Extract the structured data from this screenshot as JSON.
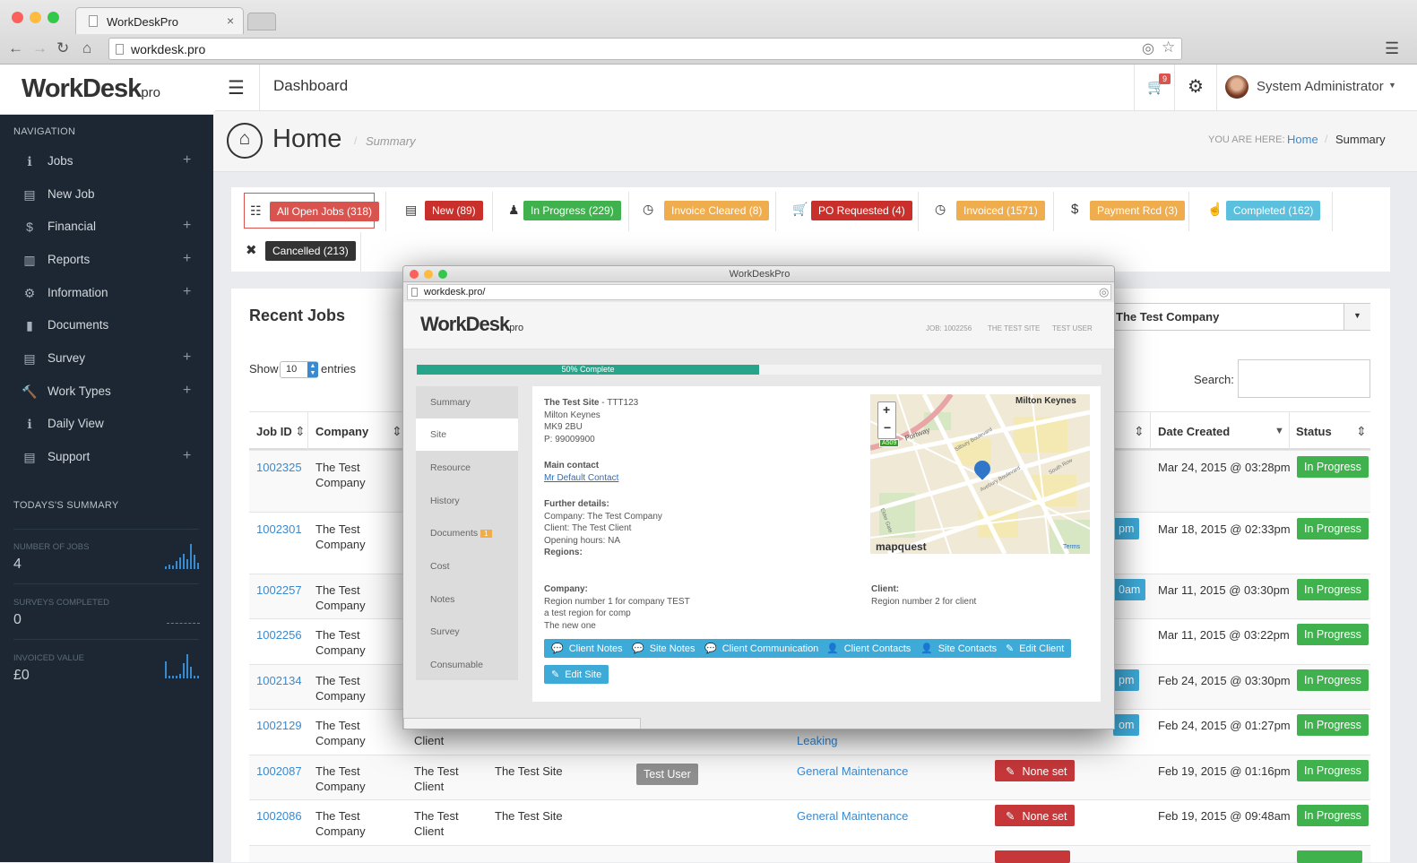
{
  "browser": {
    "tab_title": "WorkDeskPro",
    "url": "workdesk.pro"
  },
  "header": {
    "brand": "WorkDesk",
    "brand_suffix": "pro",
    "title": "Dashboard",
    "cart_count": "9",
    "user": "System Administrator"
  },
  "sidebar": {
    "heading": "NAVIGATION",
    "items": [
      {
        "label": "Jobs",
        "icon": "info-icon",
        "plus": "+"
      },
      {
        "label": "New Job",
        "icon": "list-icon",
        "plus": ""
      },
      {
        "label": "Financial",
        "icon": "dollar-icon",
        "plus": "+"
      },
      {
        "label": "Reports",
        "icon": "bar-chart-icon",
        "plus": "+"
      },
      {
        "label": "Information",
        "icon": "gears-icon",
        "plus": "+"
      },
      {
        "label": "Documents",
        "icon": "file-icon",
        "plus": ""
      },
      {
        "label": "Survey",
        "icon": "list-alt-icon",
        "plus": "+"
      },
      {
        "label": "Work Types",
        "icon": "wrench-icon",
        "plus": "+"
      },
      {
        "label": "Daily View",
        "icon": "info-icon",
        "plus": ""
      },
      {
        "label": "Support",
        "icon": "list-alt-icon",
        "plus": "+"
      }
    ],
    "summary_heading": "TODAYS'S SUMMARY",
    "stats": [
      {
        "label": "NUMBER OF JOBS",
        "value": "4"
      },
      {
        "label": "SURVEYS COMPLETED",
        "value": "0"
      },
      {
        "label": "INVOICED VALUE",
        "value": "£0"
      }
    ]
  },
  "page": {
    "title": "Home",
    "subtitle": "Summary",
    "you_are_here": "YOU ARE HERE:",
    "crumb_home": "Home",
    "crumb_current": "Summary"
  },
  "filters": [
    {
      "label": "All Open Jobs (318)",
      "color": "#d9534f"
    },
    {
      "label": "New (89)",
      "color": "#c9302c"
    },
    {
      "label": "In Progress (229)",
      "color": "#3fb24e"
    },
    {
      "label": "Invoice Cleared (8)",
      "color": "#f0ad4e"
    },
    {
      "label": "PO Requested (4)",
      "color": "#c9302c"
    },
    {
      "label": "Invoiced (1571)",
      "color": "#f0ad4e"
    },
    {
      "label": "Payment Rcd (3)",
      "color": "#f0ad4e"
    },
    {
      "label": "Completed (162)",
      "color": "#5bc0de"
    },
    {
      "label": "Cancelled (213)",
      "color": "#333333"
    }
  ],
  "recent": {
    "title": "Recent Jobs",
    "show": "Show",
    "entries_value": "10",
    "entries": "entries",
    "search_label": "Search:",
    "company_select": "The Test Company",
    "columns": {
      "job_id": "Job ID",
      "company": "Company",
      "date": "Date Created",
      "status": "Status"
    },
    "rows": [
      {
        "id": "1002325",
        "company": "The Test Company",
        "date": "Mar 24, 2015 @ 03:28pm",
        "status": "In Progress"
      },
      {
        "id": "1002301",
        "company": "The Test Company",
        "date": "Mar 18, 2015 @ 02:33pm",
        "status": "In Progress"
      },
      {
        "id": "1002257",
        "company": "The Test Company",
        "date": "Mar 11, 2015 @ 03:30pm",
        "status": "In Progress"
      },
      {
        "id": "1002256",
        "company": "The Test Company",
        "date": "Mar 11, 2015 @ 03:22pm",
        "status": "In Progress"
      },
      {
        "id": "1002134",
        "company": "The Test Company",
        "date": "Feb 24, 2015 @ 03:30pm",
        "status": "In Progress"
      },
      {
        "id": "1002129",
        "company": "The Test Company",
        "client": "Client",
        "worktype": "Leaking",
        "date": "Feb 24, 2015 @ 01:27pm",
        "status": "In Progress"
      },
      {
        "id": "1002087",
        "company": "The Test Company",
        "client": "The Test Client",
        "site": "The Test Site",
        "user": "Test User",
        "worktype": "General Maintenance",
        "po": "None set",
        "date": "Feb 19, 2015 @ 01:16pm",
        "status": "In Progress"
      },
      {
        "id": "1002086",
        "company": "The Test Company",
        "client": "The Test Client",
        "site": "The Test Site",
        "worktype": "General Maintenance",
        "po": "None set",
        "date": "Feb 19, 2015 @ 09:48am",
        "status": "In Progress"
      }
    ],
    "peek": [
      "pm",
      "0am",
      "pm",
      "om"
    ]
  },
  "popup": {
    "window_title": "WorkDeskPro",
    "url": "workdesk.pro/",
    "brand": "WorkDesk",
    "brand_suffix": "pro",
    "job": "JOB: 1002256",
    "site": "THE TEST SITE",
    "user": "TEST USER",
    "progress_label": "50% Complete",
    "progress": 0.5,
    "menu": [
      "Summary",
      "Site",
      "Resource",
      "History",
      "Documents",
      "Cost",
      "Notes",
      "Survey",
      "Consumable"
    ],
    "documents_badge": "1",
    "site_name": "The Test Site",
    "site_code": " - TTT123",
    "addr1": "Milton Keynes",
    "addr2": "MK9 2BU",
    "phone": "P: 99009900",
    "main_contact_h": "Main contact",
    "main_contact": "Mr Default Contact",
    "further_h": "Further details:",
    "further": [
      "Company: The Test Company",
      "Client: The Test Client",
      "Opening hours: NA"
    ],
    "regions_h": "Regions:",
    "company_h": "Company:",
    "company_lines": [
      "Region number 1 for company TEST",
      "a test region for comp",
      "The new one"
    ],
    "client_h": "Client:",
    "client_lines": [
      "Region number 2 for client"
    ],
    "map": {
      "city": "Milton Keynes",
      "road": "A509",
      "st1": "Portway",
      "st2": "Silbury Boulevard",
      "st3": "Avebury Boulevard",
      "st4": "South Row",
      "st5": "Elder Gate",
      "logo": "mapquest",
      "terms": "Terms",
      "zoom_in": "+",
      "zoom_out": "−"
    },
    "buttons": [
      "Client Notes",
      "Site Notes",
      "Client Communication",
      "Client Contacts",
      "Site Contacts",
      "Edit Client",
      "Edit Site"
    ]
  }
}
